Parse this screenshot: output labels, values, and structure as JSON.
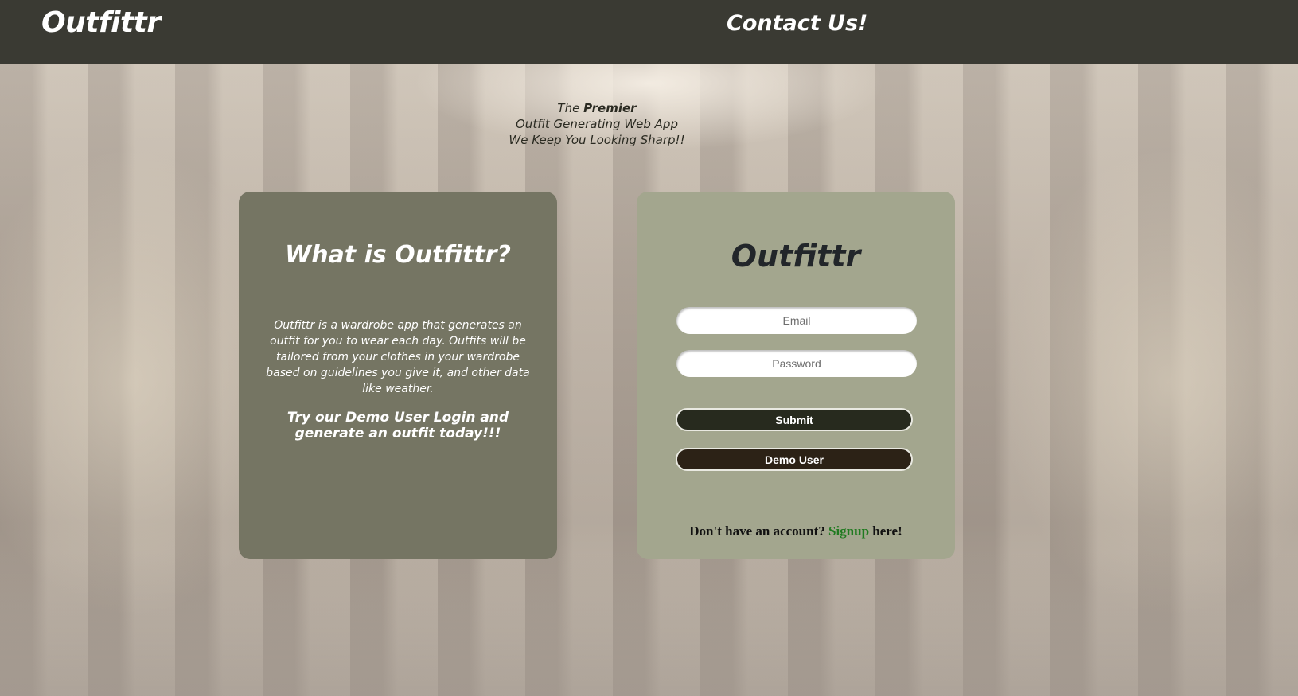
{
  "header": {
    "brand": "Outfittr",
    "contact_link": "Contact Us!"
  },
  "tagline": {
    "line1_pre": "The",
    "line1_bold": "Premier",
    "line2": "Outfit Generating Web App",
    "line3_pre": "We Keep You Looking",
    "line3_em": "Sharp!!"
  },
  "info_card": {
    "title": "What is Outfittr?",
    "description": "Outfittr is a wardrobe app that generates an outfit for you to wear each day. Outfits will be tailored from your clothes in your wardrobe based on guidelines you give it, and other data like weather.",
    "cta": "Try our Demo User Login and generate an outfit today!!!"
  },
  "login_card": {
    "title": "Outfittr",
    "email_placeholder": "Email",
    "password_placeholder": "Password",
    "submit_label": "Submit",
    "demo_label": "Demo User",
    "signup_prefix": "Don't have an account?",
    "signup_link": "Signup",
    "signup_suffix": "here!"
  },
  "colors": {
    "header_bg": "#3a3a33",
    "info_card_bg": "#757563",
    "login_card_bg": "#a3a68e",
    "submit_bg": "#272a1e",
    "demo_bg": "#2c2216",
    "signup_link": "#1f7a1f"
  }
}
